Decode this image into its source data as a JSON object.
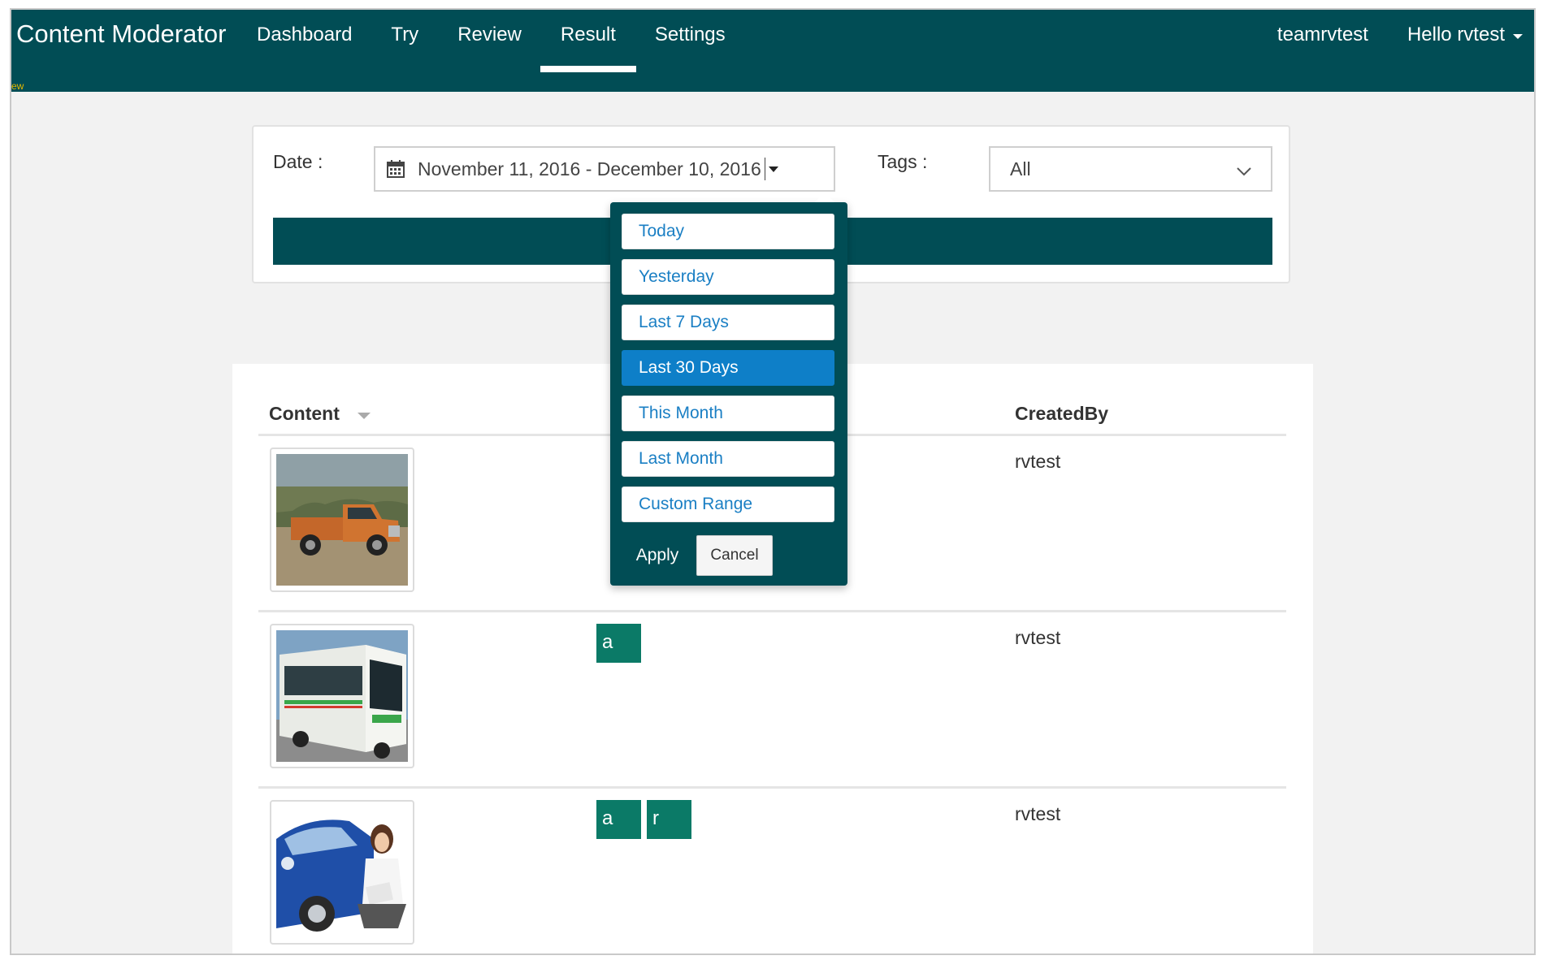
{
  "navbar": {
    "brand": "Content Moderator",
    "items": [
      {
        "label": "Dashboard",
        "active": false
      },
      {
        "label": "Try",
        "active": false
      },
      {
        "label": "Review",
        "active": false
      },
      {
        "label": "Result",
        "active": true
      },
      {
        "label": "Settings",
        "active": false
      }
    ],
    "team": "teamrvtest",
    "user_greeting": "Hello rvtest",
    "corner_mark": "ew"
  },
  "filters": {
    "date_label": "Date :",
    "date_range": "November 11, 2016 - December 10, 2016",
    "tags_label": "Tags :",
    "tags_value": "All"
  },
  "date_picker": {
    "ranges": [
      "Today",
      "Yesterday",
      "Last 7 Days",
      "Last 30 Days",
      "This Month",
      "Last Month",
      "Custom Range"
    ],
    "selected": "Last 30 Days",
    "apply_label": "Apply",
    "cancel_label": "Cancel"
  },
  "table": {
    "columns": {
      "content": "Content",
      "created_by": "CreatedBy"
    },
    "rows": [
      {
        "image": "orange-pickup-truck",
        "tags": [],
        "created_by": "rvtest"
      },
      {
        "image": "city-bus",
        "tags": [
          "a"
        ],
        "created_by": "rvtest"
      },
      {
        "image": "blue-car-woman",
        "tags": [
          "a",
          "r"
        ],
        "created_by": "rvtest"
      }
    ]
  },
  "colors": {
    "nav_bg": "#014d55",
    "tag_bg": "#0b7a67",
    "selected_range": "#0e7fc8",
    "range_text": "#1a7fc4"
  }
}
